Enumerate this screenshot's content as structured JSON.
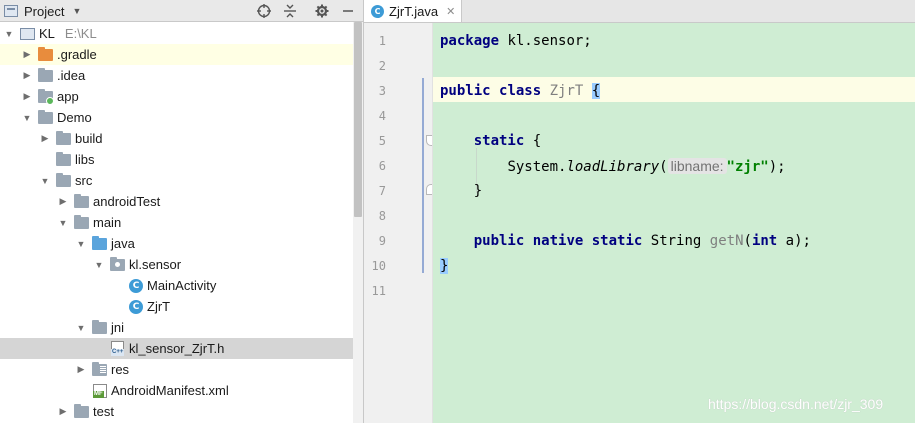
{
  "project_panel": {
    "title": "Project",
    "tree": [
      {
        "label": "KL",
        "path": "E:\\KL"
      },
      {
        "label": ".gradle"
      },
      {
        "label": ".idea"
      },
      {
        "label": "app"
      },
      {
        "label": "Demo"
      },
      {
        "label": "build"
      },
      {
        "label": "libs"
      },
      {
        "label": "src"
      },
      {
        "label": "androidTest"
      },
      {
        "label": "main"
      },
      {
        "label": "java"
      },
      {
        "label": "kl.sensor"
      },
      {
        "label": "MainActivity"
      },
      {
        "label": "ZjrT"
      },
      {
        "label": "jni"
      },
      {
        "label": "kl_sensor_ZjrT.h"
      },
      {
        "label": "res"
      },
      {
        "label": "AndroidManifest.xml"
      },
      {
        "label": "test"
      }
    ]
  },
  "editor": {
    "tab_label": "ZjrT.java",
    "line_numbers": [
      "1",
      "2",
      "3",
      "4",
      "5",
      "6",
      "7",
      "8",
      "9",
      "10",
      "11"
    ],
    "code": {
      "l1_kw": "package",
      "l1_rest": " kl.sensor;",
      "l3_kw1": "public",
      "l3_kw2": "class",
      "l3_cls": "ZjrT",
      "l3_brace": "{",
      "l5_kw": "static",
      "l5_rest": " {",
      "l6_obj": "System.",
      "l6_method": "loadLibrary",
      "l6_open": "(",
      "l6_hint": "libname:",
      "l6_str": "\"zjr\"",
      "l6_close": ");",
      "l7_brace": "}",
      "l9_kw1": "public",
      "l9_kw2": "native",
      "l9_kw3": "static",
      "l9_type": "String",
      "l9_name": "getN",
      "l9_open": "(",
      "l9_kw4": "int",
      "l9_rest": " a);",
      "l10_brace": "}"
    }
  },
  "watermark": "https://blog.csdn.net/zjr_309"
}
